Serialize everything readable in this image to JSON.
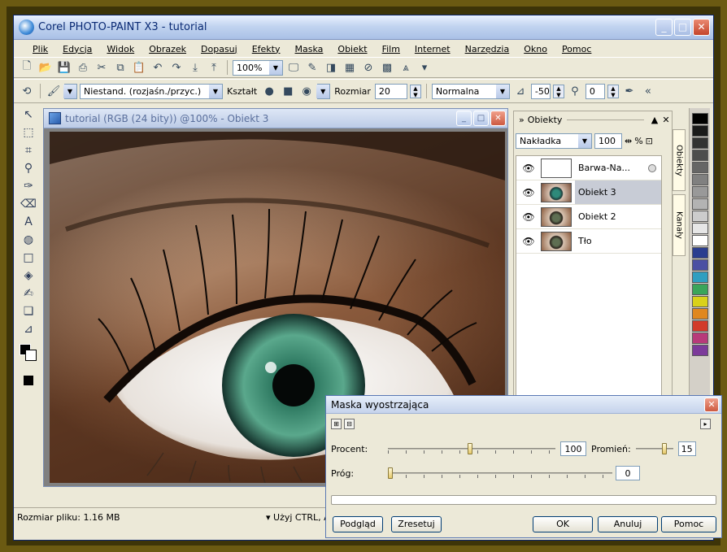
{
  "window": {
    "title": "Corel PHOTO-PAINT X3 - tutorial",
    "buttons": [
      "_",
      "□",
      "✕"
    ]
  },
  "menu": [
    "Plik",
    "Edycja",
    "Widok",
    "Obrazek",
    "Dopasuj",
    "Efekty",
    "Maska",
    "Obiekt",
    "Film",
    "Internet",
    "Narzędzia",
    "Okno",
    "Pomoc"
  ],
  "toolbar1": {
    "zoom": "100%",
    "icons": [
      "new-icon",
      "open-icon",
      "save-icon",
      "print-icon",
      "cut-icon",
      "copy-icon",
      "paste-icon",
      "undo-icon",
      "redo-icon",
      "import-icon",
      "export-icon"
    ]
  },
  "toolbar2": {
    "brush_type": "Niestand. (rozjaśn./przyc.)",
    "shape_label": "Kształt",
    "size_label": "Rozmiar",
    "size_value": "20",
    "blend_mode": "Normalna",
    "amount_value": "-50",
    "transparency_value": "0"
  },
  "document": {
    "title": "tutorial (RGB (24 bity)) @100% - Obiekt 3"
  },
  "panel": {
    "title": "Obiekty",
    "merge_mode": "Nakładka",
    "opacity_value": "100",
    "opacity_unit": "%",
    "layers": [
      {
        "name": "Barwa-Na...",
        "thumb": "white"
      },
      {
        "name": "Obiekt 3",
        "thumb": "teal",
        "selected": true
      },
      {
        "name": "Obiekt 2",
        "thumb": "brown"
      },
      {
        "name": "Tło",
        "thumb": "brown"
      }
    ],
    "tabs": [
      "Obiekty",
      "Kanały"
    ]
  },
  "palette_colors": [
    "#000000",
    "#1a1a1a",
    "#333333",
    "#4d4d4d",
    "#666666",
    "#808080",
    "#999999",
    "#b3b3b3",
    "#cccccc",
    "#e6e6e6",
    "#ffffff",
    "#2a3d8f",
    "#4b4fa3",
    "#2f9ec0",
    "#3aa55a",
    "#d9d21a",
    "#e0871f",
    "#d23a2a",
    "#b83a7a",
    "#7c3a9a"
  ],
  "status": {
    "file_size": "Rozmiar pliku: 1.16 MB",
    "hint": "Użyj CTRL, A"
  },
  "dialog": {
    "title": "Maska wyostrzająca",
    "percent_label": "Procent:",
    "percent_value": "100",
    "radius_label": "Promień:",
    "radius_value": "15",
    "threshold_label": "Próg:",
    "threshold_value": "0",
    "preview_btn": "Podgląd",
    "reset_btn": "Zresetuj",
    "ok_btn": "OK",
    "cancel_btn": "Anuluj",
    "help_btn": "Pomoc"
  }
}
